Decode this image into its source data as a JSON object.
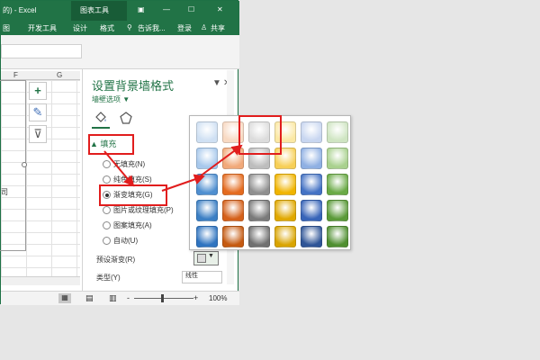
{
  "titlebar": {
    "left_fragment": "的) - Excel",
    "tool_tab": "图表工具",
    "controls": [
      "▣",
      "—",
      "☐",
      "✕"
    ]
  },
  "ribbon": {
    "tabs": [
      "图",
      "开发工具",
      "设计",
      "格式"
    ],
    "search": "告诉我...",
    "login": "登录",
    "share": "共享"
  },
  "sheet": {
    "col_f": "F",
    "col_g": "G",
    "side_buttons": [
      "+",
      "✎",
      "⊽"
    ],
    "left_char": "司"
  },
  "status": {
    "zoom_minus": "-",
    "zoom_plus": "+",
    "zoom": "100%"
  },
  "pane": {
    "title": "设置背景墙格式",
    "subtitle": "墙壁选项 ▼",
    "pin": "▼",
    "close": "✕",
    "fill_section": "▲ 填充",
    "options": [
      "无填充(N)",
      "纯色填充(S)",
      "渐变填充(G)",
      "图片或纹理填充(P)",
      "图案填充(A)",
      "自动(U)"
    ],
    "selected_index": 2,
    "preset_label": "预设渐变(R)",
    "type_label": "类型(Y)",
    "type_value": "线性"
  },
  "gallery": {
    "colors": [
      [
        "#cfe0f3",
        "#f8d9c2",
        "#dcdcdc",
        "#fbe8a4",
        "#c8d6f0",
        "#cfe5c2"
      ],
      [
        "#a7c8ec",
        "#f1a97a",
        "#bdbdbd",
        "#f7cf56",
        "#8fb0e3",
        "#a9d18e"
      ],
      [
        "#4f8fd0",
        "#e46b1f",
        "#8f8f8f",
        "#f0b400",
        "#4472c4",
        "#6aaa46"
      ],
      [
        "#3b7fc4",
        "#d4601a",
        "#7a7a7a",
        "#e0a800",
        "#3764b8",
        "#5a9a38"
      ],
      [
        "#2f74c0",
        "#c55a11",
        "#707070",
        "#d9a400",
        "#2f5597",
        "#4f8f30"
      ]
    ],
    "highlight_color": "#e11d1d"
  }
}
